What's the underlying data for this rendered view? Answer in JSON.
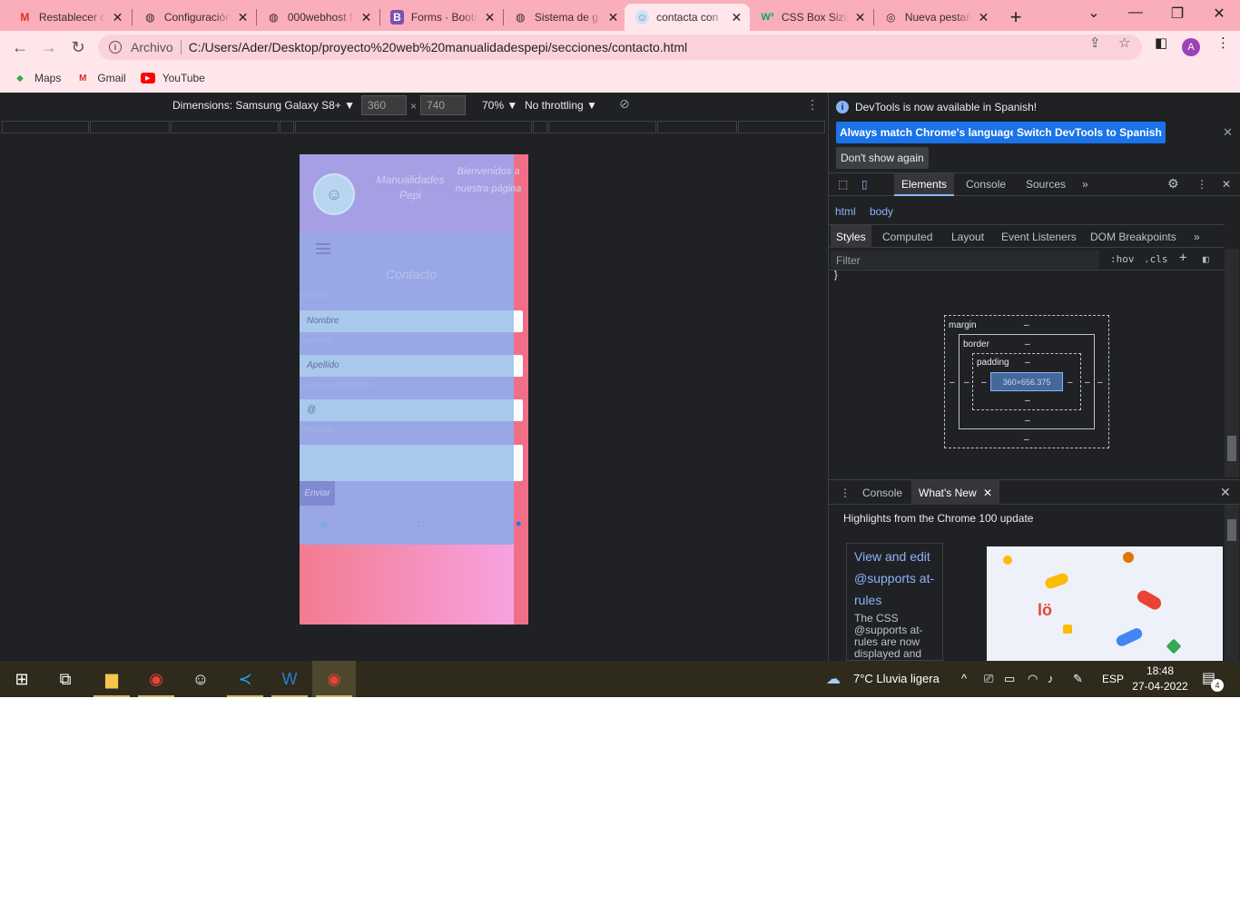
{
  "tabs": [
    {
      "title": "Restablecer c",
      "icon": "gmail-icon",
      "glyph": "M",
      "color": "#d93025"
    },
    {
      "title": "Configuración",
      "icon": "globe-icon",
      "glyph": "◍",
      "color": "#333333"
    },
    {
      "title": "000webhost f",
      "icon": "globe-icon",
      "glyph": "◍",
      "color": "#333333"
    },
    {
      "title": "Forms · Boots",
      "icon": "bootstrap-icon",
      "glyph": "B",
      "color": "#7952b3"
    },
    {
      "title": "Sistema de g",
      "icon": "globe-icon",
      "glyph": "◍",
      "color": "#333333"
    },
    {
      "title": "contacta con",
      "icon": "site-logo-icon",
      "glyph": "☺",
      "color": "#6c8fc6"
    },
    {
      "title": "CSS Box Sizin",
      "icon": "w3schools-icon",
      "glyph": "W³",
      "color": "#04aa6d"
    },
    {
      "title": "Nueva pestañ",
      "icon": "chrome-icon",
      "glyph": "◎",
      "color": "#555555"
    }
  ],
  "omnibox": {
    "scheme": "Archivo",
    "url": "C:/Users/Ader/Desktop/proyecto%20web%20manualidadespepi/secciones/contacto.html",
    "avatar": "A"
  },
  "bookmarks": [
    {
      "label": "Maps",
      "icon": "maps-icon"
    },
    {
      "label": "Gmail",
      "icon": "gmail-icon"
    },
    {
      "label": "YouTube",
      "icon": "youtube-icon"
    }
  ],
  "device_toolbar": {
    "dimensions": "Dimensions: Samsung Galaxy S8+ ▼",
    "width": "360",
    "height": "740",
    "x": "×",
    "zoom": "70% ▼",
    "throttling": "No throttling ▼"
  },
  "phone_page": {
    "brand": "Manualidades Pepi",
    "welcome": "Bienvenidos a nuestra página",
    "form_title": "Contacto",
    "fields": [
      {
        "label": "Nombre",
        "placeholder": "Nombre"
      },
      {
        "label": "Apellido",
        "placeholder": "Apellido"
      },
      {
        "label": "Correo electrónico",
        "placeholder": "@"
      }
    ],
    "message_label": "Mensaje",
    "submit": "Enviar"
  },
  "devtools": {
    "info_text": "DevTools is now available in Spanish!",
    "btn_match": "Always match Chrome's language",
    "btn_switch": "Switch DevTools to Spanish",
    "btn_dont_show": "Don't show again",
    "main_tabs": [
      "Elements",
      "Console",
      "Sources"
    ],
    "breadcrumbs": [
      "html",
      "body"
    ],
    "sub_tabs": [
      "Styles",
      "Computed",
      "Layout",
      "Event Listeners",
      "DOM Breakpoints"
    ],
    "filter_placeholder": "Filter",
    "hov": ":hov",
    "cls": ".cls",
    "rule_brace": "}",
    "box_model": {
      "margin": "margin",
      "border": "border",
      "padding": "padding",
      "dash": "–",
      "content": "360×656.375"
    },
    "drawer_tabs": [
      "Console",
      "What's New"
    ],
    "highlight": "Highlights from the Chrome 100 update",
    "card_title": "View and edit @supports at-rules",
    "card_desc": "The CSS @supports at-rules are now displayed and editable in the"
  },
  "taskbar": {
    "weather": "7°C  Lluvia ligera",
    "lang": "ESP",
    "time": "18:48",
    "date": "27-04-2022",
    "notifications": "4"
  },
  "colors": {
    "tabstrip": "#f9aeba",
    "toolbar": "#ffe6ea",
    "devtools_bg": "#202124",
    "accent_blue": "#1a73e8"
  }
}
